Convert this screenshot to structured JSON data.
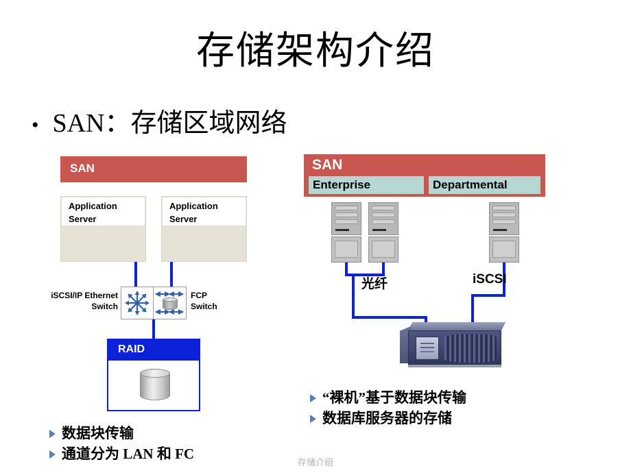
{
  "slide": {
    "title": "存储架构介绍",
    "footer": "存储介绍",
    "main_bullet": {
      "marker": "•",
      "text": "SAN：存储区域网络"
    }
  },
  "left_diagram": {
    "san_header": "SAN",
    "app_servers": [
      {
        "line1": "Application",
        "line2": "Server"
      },
      {
        "line1": "Application",
        "line2": "Server"
      }
    ],
    "switches": {
      "ethernet_caption_line1": "iSCSI/IP Ethernet",
      "ethernet_caption_line2": "Switch",
      "fcp_caption_line1": "FCP",
      "fcp_caption_line2": "Switch"
    },
    "raid": {
      "header": "RAID"
    },
    "bullets": [
      "数据块传输",
      "通道分为 LAN 和 FC"
    ]
  },
  "right_diagram": {
    "san_header": "SAN",
    "tiers": [
      "Enterprise",
      "Departmental"
    ],
    "links": {
      "fiber": "光纤",
      "iscsi": "iSCSI"
    },
    "bullets": [
      "“裸机”基于数据块传输",
      "数据库服务器的存储"
    ]
  },
  "colors": {
    "san_red": "#c8584f",
    "tier_teal": "#b5d6d3",
    "link_blue": "#0d22d8",
    "raid_blue": "#0d22d8",
    "app_server_beige": "#e5e3d6",
    "bullet_marker": "#5b7fb5",
    "footer_gray": "#b3b3b3"
  }
}
